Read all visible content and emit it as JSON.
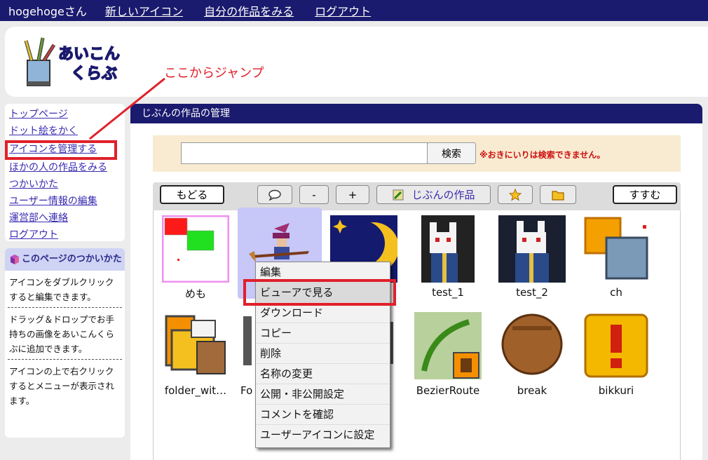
{
  "nav": {
    "user": "hogehogeさん",
    "links": [
      "新しいアイコン",
      "自分の作品をみる",
      "ログアウト"
    ]
  },
  "header": {
    "logo_line1": "あいこん",
    "logo_line2": "くらぶ",
    "annotation": "ここからジャンプ"
  },
  "sidebar": {
    "links": [
      "トップページ",
      "ドット絵をかく",
      "アイコンを管理する",
      "ほかの人の作品をみる",
      "つかいかた",
      "ユーザー情報の編集",
      "運営部へ連絡",
      "ログアウト"
    ],
    "highlighted_index": 2
  },
  "help": {
    "title": "このページのつかいかた",
    "paragraphs": [
      "アイコンをダブルクリックすると編集できます。",
      "ドラッグ＆ドロップでお手持ちの画像をあいこんくらぶに追加できます。",
      "アイコンの上で右クリックするとメニューが表示されます。"
    ]
  },
  "main": {
    "title": "じぶんの作品の管理",
    "search": {
      "value": "",
      "placeholder": "",
      "button": "検索",
      "note": "※おきにいりは検索できません。"
    },
    "toolbar": {
      "back": "もどる",
      "comment": "💬",
      "minus": "-",
      "plus": "+",
      "folder_label": "じぶんの作品",
      "star": "★",
      "folder_icon": "📁",
      "next": "すすむ"
    },
    "icons": [
      {
        "label": "めも"
      },
      {
        "label": ""
      },
      {
        "label": ""
      },
      {
        "label": "test_1"
      },
      {
        "label": "test_2"
      },
      {
        "label": "ch"
      },
      {
        "label": "folder_wit…"
      },
      {
        "label": "Fo"
      },
      {
        "label": ""
      },
      {
        "label": "BezierRoute"
      },
      {
        "label": "break"
      },
      {
        "label": "bikkuri"
      }
    ]
  },
  "context_menu": {
    "items": [
      "編集",
      "ビューアで見る",
      "ダウンロード",
      "コピー",
      "削除",
      "名称の変更",
      "公開・非公開設定",
      "コメントを確認",
      "ユーザーアイコンに設定"
    ],
    "highlighted_index": 1
  },
  "colors": {
    "nav_bg": "#1a1a6e",
    "annotation": "#e0202a",
    "link": "#3a2cb0",
    "selected": "#c7c7f8"
  }
}
